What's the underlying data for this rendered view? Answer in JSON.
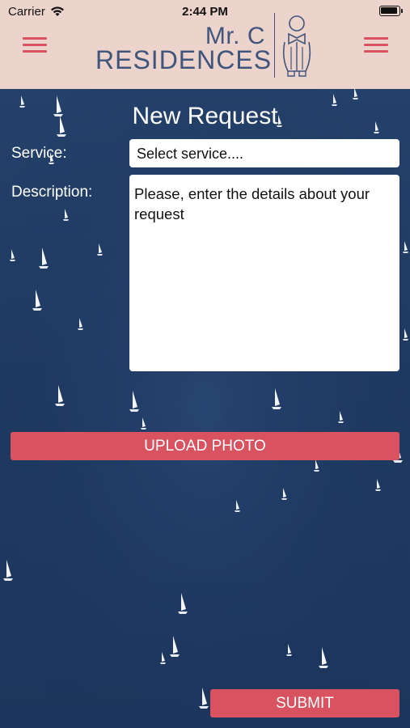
{
  "status_bar": {
    "carrier": "Carrier",
    "time": "2:44 PM",
    "wifi_icon": "wifi-icon",
    "battery_icon": "battery-icon"
  },
  "header": {
    "logo_line1": "Mr. C",
    "logo_line2": "RESIDENCES",
    "left_menu_icon": "hamburger-menu-icon",
    "right_menu_icon": "hamburger-menu-icon",
    "background_color": "#ecd3cb",
    "accent_color": "#d8525f",
    "logo_color": "#40557c"
  },
  "form": {
    "title": "New Request",
    "service_label": "Service:",
    "service_value": "Select service....",
    "description_label": "Description:",
    "description_placeholder": "Please, enter the details about your request",
    "upload_button": "UPLOAD PHOTO",
    "submit_button": "SUBMIT"
  },
  "background": {
    "description_image": "sailboats-on-sea",
    "sea_color": "#223a5e"
  }
}
